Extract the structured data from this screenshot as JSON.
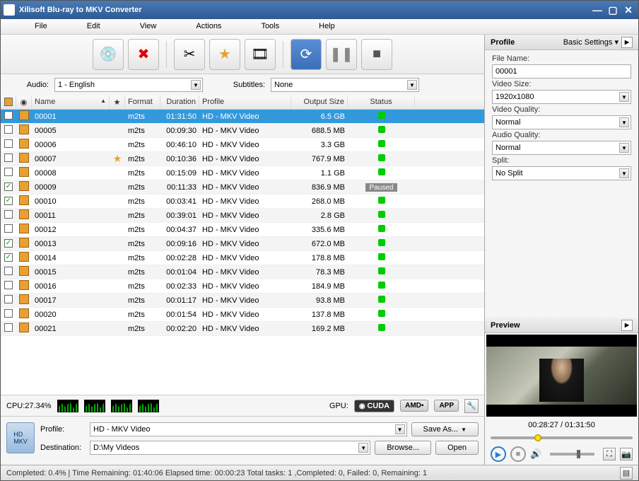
{
  "window": {
    "title": "Xilisoft Blu-ray to MKV Converter"
  },
  "menu": {
    "file": "File",
    "edit": "Edit",
    "view": "View",
    "actions": "Actions",
    "tools": "Tools",
    "help": "Help"
  },
  "filters": {
    "audio_label": "Audio:",
    "audio_value": "1 - English",
    "subtitles_label": "Subtitles:",
    "subtitles_value": "None"
  },
  "columns": {
    "name": "Name",
    "format": "Format",
    "duration": "Duration",
    "profile": "Profile",
    "output_size": "Output Size",
    "status": "Status"
  },
  "rows": [
    {
      "chk": false,
      "name": "00001",
      "star": false,
      "format": "m2ts",
      "duration": "01:31:50",
      "profile": "HD - MKV Video",
      "size": "6.5 GB",
      "status": "ok",
      "sel": true
    },
    {
      "chk": false,
      "name": "00005",
      "star": false,
      "format": "m2ts",
      "duration": "00:09:30",
      "profile": "HD - MKV Video",
      "size": "688.5 MB",
      "status": "ok"
    },
    {
      "chk": false,
      "name": "00006",
      "star": false,
      "format": "m2ts",
      "duration": "00:46:10",
      "profile": "HD - MKV Video",
      "size": "3.3 GB",
      "status": "ok"
    },
    {
      "chk": false,
      "name": "00007",
      "star": true,
      "format": "m2ts",
      "duration": "00:10:36",
      "profile": "HD - MKV Video",
      "size": "767.9 MB",
      "status": "ok"
    },
    {
      "chk": false,
      "name": "00008",
      "star": false,
      "format": "m2ts",
      "duration": "00:15:09",
      "profile": "HD - MKV Video",
      "size": "1.1 GB",
      "status": "ok"
    },
    {
      "chk": true,
      "name": "00009",
      "star": false,
      "format": "m2ts",
      "duration": "00:11:33",
      "profile": "HD - MKV Video",
      "size": "836.9 MB",
      "status": "Paused"
    },
    {
      "chk": true,
      "name": "00010",
      "star": false,
      "format": "m2ts",
      "duration": "00:03:41",
      "profile": "HD - MKV Video",
      "size": "268.0 MB",
      "status": "ok"
    },
    {
      "chk": false,
      "name": "00011",
      "star": false,
      "format": "m2ts",
      "duration": "00:39:01",
      "profile": "HD - MKV Video",
      "size": "2.8 GB",
      "status": "ok"
    },
    {
      "chk": false,
      "name": "00012",
      "star": false,
      "format": "m2ts",
      "duration": "00:04:37",
      "profile": "HD - MKV Video",
      "size": "335.6 MB",
      "status": "ok"
    },
    {
      "chk": true,
      "name": "00013",
      "star": false,
      "format": "m2ts",
      "duration": "00:09:16",
      "profile": "HD - MKV Video",
      "size": "672.0 MB",
      "status": "ok"
    },
    {
      "chk": true,
      "name": "00014",
      "star": false,
      "format": "m2ts",
      "duration": "00:02:28",
      "profile": "HD - MKV Video",
      "size": "178.8 MB",
      "status": "ok"
    },
    {
      "chk": false,
      "name": "00015",
      "star": false,
      "format": "m2ts",
      "duration": "00:01:04",
      "profile": "HD - MKV Video",
      "size": "78.3 MB",
      "status": "ok"
    },
    {
      "chk": false,
      "name": "00016",
      "star": false,
      "format": "m2ts",
      "duration": "00:02:33",
      "profile": "HD - MKV Video",
      "size": "184.9 MB",
      "status": "ok"
    },
    {
      "chk": false,
      "name": "00017",
      "star": false,
      "format": "m2ts",
      "duration": "00:01:17",
      "profile": "HD - MKV Video",
      "size": "93.8 MB",
      "status": "ok"
    },
    {
      "chk": false,
      "name": "00020",
      "star": false,
      "format": "m2ts",
      "duration": "00:01:54",
      "profile": "HD - MKV Video",
      "size": "137.8 MB",
      "status": "ok"
    },
    {
      "chk": false,
      "name": "00021",
      "star": false,
      "format": "m2ts",
      "duration": "00:02:20",
      "profile": "HD - MKV Video",
      "size": "169.2 MB",
      "status": "ok"
    }
  ],
  "cpu": {
    "label": "CPU:27.34%"
  },
  "gpu": {
    "label": "GPU:",
    "cuda": "CUDA",
    "amd": "AMD▪",
    "app": "APP"
  },
  "profilebox": {
    "profile_label": "Profile:",
    "profile_value": "HD - MKV Video",
    "dest_label": "Destination:",
    "dest_value": "D:\\My Videos",
    "saveas": "Save As...",
    "browse": "Browse...",
    "open": "Open"
  },
  "sidebar": {
    "profile_title": "Profile",
    "basic": "Basic Settings ▾",
    "file_name_label": "File Name:",
    "file_name": "00001",
    "video_size_label": "Video Size:",
    "video_size": "1920x1080",
    "video_quality_label": "Video Quality:",
    "video_quality": "Normal",
    "audio_quality_label": "Audio Quality:",
    "audio_quality": "Normal",
    "split_label": "Split:",
    "split": "No Split",
    "preview_title": "Preview",
    "time": "00:28:27 / 01:31:50"
  },
  "statusbar": {
    "text": "Completed: 0.4% | Time Remaining: 01:40:06 Elapsed time: 00:00:23 Total tasks: 1 ,Completed: 0, Failed: 0, Remaining: 1"
  }
}
